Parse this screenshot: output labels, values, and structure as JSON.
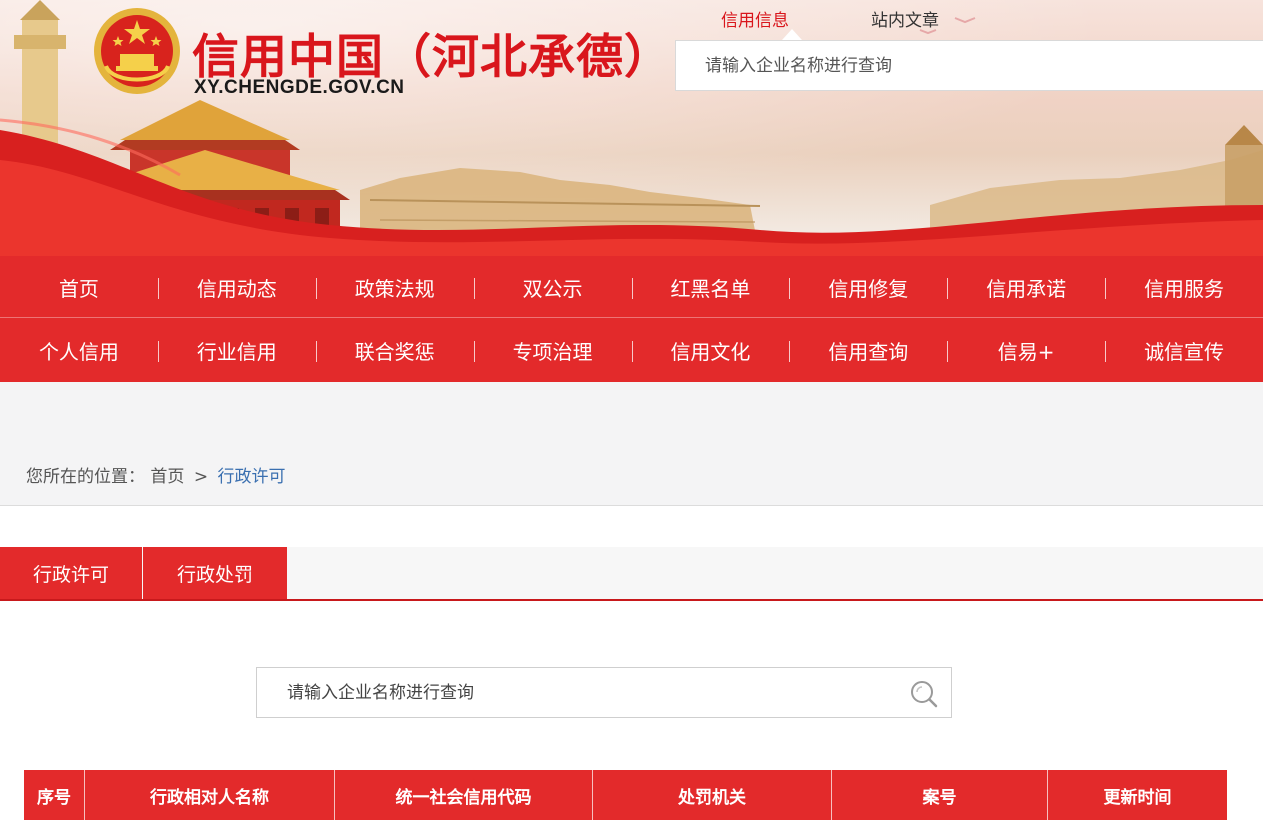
{
  "header": {
    "site_title": "信用中国（河北承德）",
    "site_domain": "XY.CHENGDE.GOV.CN",
    "top_tabs": [
      {
        "label": "信用信息",
        "active": true
      },
      {
        "label": "站内文章",
        "active": false
      }
    ],
    "search_placeholder": "请输入企业名称进行查询"
  },
  "nav": {
    "row1": [
      "首页",
      "信用动态",
      "政策法规",
      "双公示",
      "红黑名单",
      "信用修复",
      "信用承诺",
      "信用服务"
    ],
    "row2": [
      "个人信用",
      "行业信用",
      "联合奖惩",
      "专项治理",
      "信用文化",
      "信用查询",
      "信易+",
      "诚信宣传"
    ]
  },
  "breadcrumb": {
    "prefix": "您所在的位置：",
    "home": "首页",
    "separator": ">",
    "current": "行政许可"
  },
  "content": {
    "tabs": [
      {
        "label": "行政许可",
        "active": true
      },
      {
        "label": "行政处罚",
        "active": false
      }
    ],
    "search_placeholder": "请输入企业名称进行查询",
    "table_headers": [
      "序号",
      "行政相对人名称",
      "统一社会信用代码",
      "处罚机关",
      "案号",
      "更新时间"
    ]
  },
  "colors": {
    "brand_red": "#e32a2b",
    "title_red": "#d9161c",
    "link_blue": "#3a6fb0"
  }
}
